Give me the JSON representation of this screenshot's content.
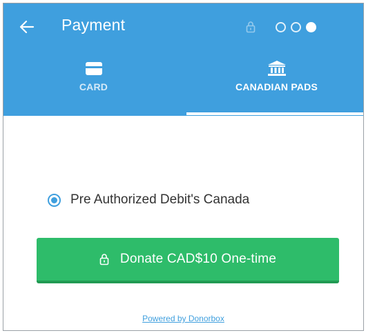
{
  "header": {
    "title": "Payment",
    "steps": [
      {
        "active": false
      },
      {
        "active": false
      },
      {
        "active": true
      }
    ]
  },
  "tabs": [
    {
      "label": "CARD",
      "icon": "credit-card-icon",
      "selected": false
    },
    {
      "label": "CANADIAN PADS",
      "icon": "bank-icon",
      "selected": true
    }
  ],
  "option": {
    "label": "Pre Authorized Debit's Canada",
    "selected": true
  },
  "donate": {
    "label": "Donate CAD$10 One-time",
    "icon": "lock-icon"
  },
  "footer": {
    "powered_label": "Powered by Donorbox"
  },
  "colors": {
    "primary": "#3f9fde",
    "donate": "#2ebc6a",
    "text": "#333333"
  }
}
